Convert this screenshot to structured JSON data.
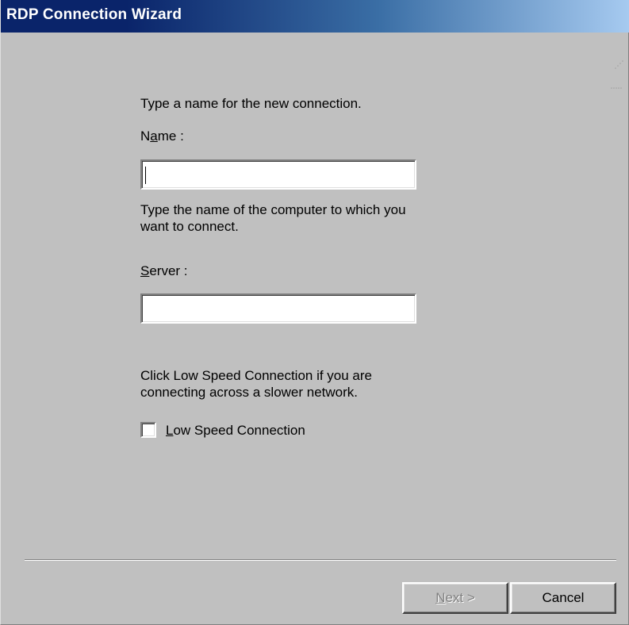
{
  "window": {
    "title": "RDP Connection Wizard"
  },
  "name_section": {
    "instruction": "Type a name for the new connection.",
    "label": "Name :",
    "value": "",
    "placeholder": ""
  },
  "server_section": {
    "instruction_line1": "Type the  name of the computer  to which you",
    "instruction_line2": "want to connect.",
    "label": "Server :",
    "value": "",
    "placeholder": ""
  },
  "low_speed_section": {
    "instruction_line1": "Click Low Speed  Connection if you are",
    "instruction_line2": "connecting across a slower  network.",
    "checkbox_label": "Low Speed Connection",
    "checked": false
  },
  "buttons": {
    "next": "Next >",
    "cancel": "Cancel"
  },
  "colors": {
    "face": "#c0c0c0",
    "title_start": "#0a246a",
    "title_end": "#a6caf0",
    "disabled_text": "#808080"
  },
  "icons": {
    "checkbox": "checkbox-unchecked-icon",
    "corner": "dotted-corner-icon"
  }
}
